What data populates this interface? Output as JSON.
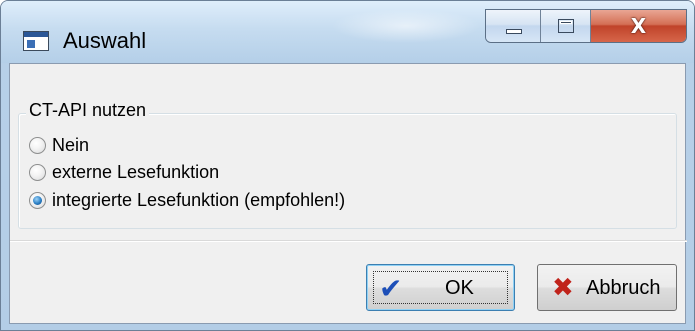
{
  "window": {
    "title": "Auswahl",
    "icon": "app-window-icon"
  },
  "caption_buttons": {
    "minimize_icon": "minimize-icon",
    "maximize_icon": "maximize-icon",
    "close_glyph": "X"
  },
  "group": {
    "title": "CT-API nutzen",
    "options": [
      {
        "label": "Nein",
        "checked": false
      },
      {
        "label": "externe Lesefunktion",
        "checked": false
      },
      {
        "label": "integrierte Lesefunktion (empfohlen!)",
        "checked": true
      }
    ]
  },
  "buttons": {
    "ok_label": "OK",
    "ok_icon": "checkmark-icon",
    "cancel_label": "Abbruch",
    "cancel_icon": "x-icon"
  },
  "colors": {
    "checkmark": "#1d4fb8",
    "cancel_x": "#c0231b",
    "close_button": "#c0432a"
  }
}
